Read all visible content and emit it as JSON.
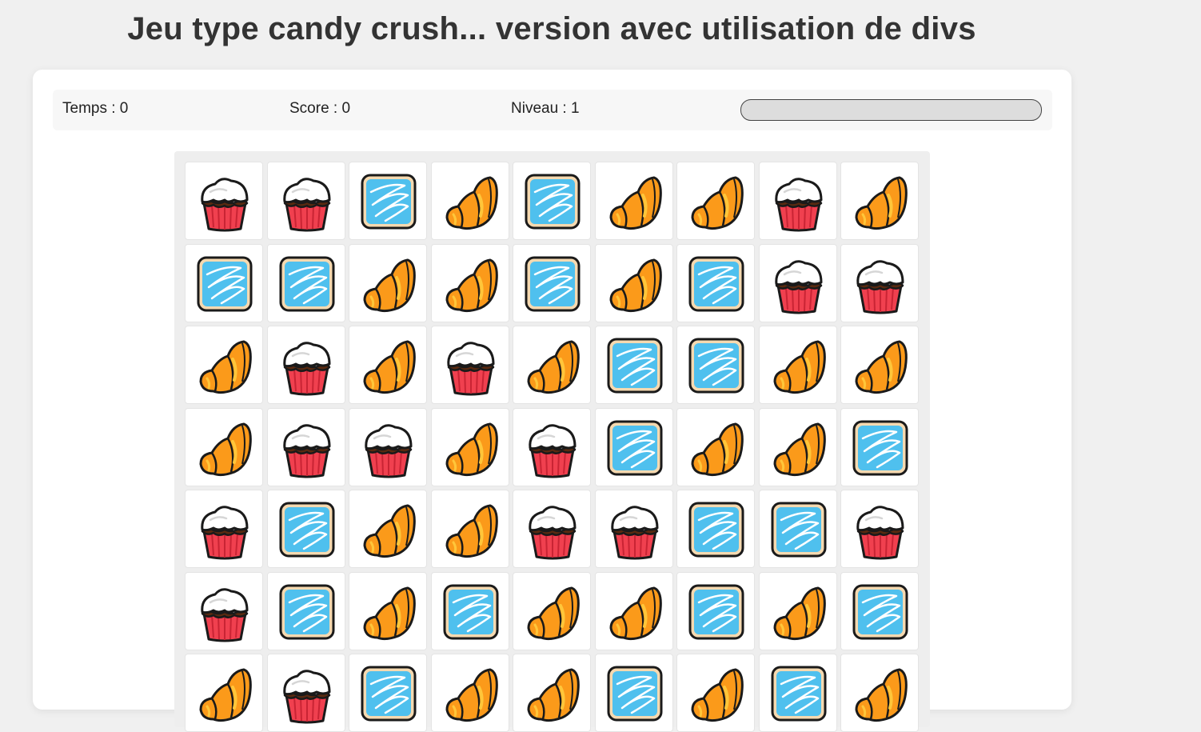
{
  "title": "Jeu type candy crush... version avec utilisation de divs",
  "status": {
    "time_text": "Temps : 0",
    "score_text": "Score : 0",
    "level_text": "Niveau : 1",
    "progress_fraction": 0
  },
  "board": {
    "cols": 9,
    "visible_rows": 7,
    "rows": [
      [
        "cupcake",
        "cupcake",
        "ice-cake",
        "croissant",
        "ice-cake",
        "croissant",
        "croissant",
        "cupcake",
        "croissant"
      ],
      [
        "ice-cake",
        "ice-cake",
        "croissant",
        "croissant",
        "ice-cake",
        "croissant",
        "ice-cake",
        "cupcake",
        "cupcake"
      ],
      [
        "croissant",
        "cupcake",
        "croissant",
        "cupcake",
        "croissant",
        "ice-cake",
        "ice-cake",
        "croissant",
        "croissant"
      ],
      [
        "croissant",
        "cupcake",
        "cupcake",
        "croissant",
        "cupcake",
        "ice-cake",
        "croissant",
        "croissant",
        "ice-cake"
      ],
      [
        "cupcake",
        "ice-cake",
        "croissant",
        "croissant",
        "cupcake",
        "cupcake",
        "ice-cake",
        "ice-cake",
        "cupcake"
      ],
      [
        "cupcake",
        "ice-cake",
        "croissant",
        "ice-cake",
        "croissant",
        "croissant",
        "ice-cake",
        "croissant",
        "ice-cake"
      ],
      [
        "croissant",
        "cupcake",
        "ice-cake",
        "croissant",
        "croissant",
        "ice-cake",
        "croissant",
        "ice-cake",
        "croissant"
      ]
    ]
  },
  "colors": {
    "cupcake_cup": "#f0404f",
    "cupcake_cream": "#ffffff",
    "cupcake_chocolate": "#5a2a10",
    "croissant": "#fb9a1a",
    "croissant_highlight": "#ffc63a",
    "ice_cake": "#4fc0ee",
    "ice_cake_border": "#f5d9b0",
    "outline": "#1a1a1a"
  }
}
